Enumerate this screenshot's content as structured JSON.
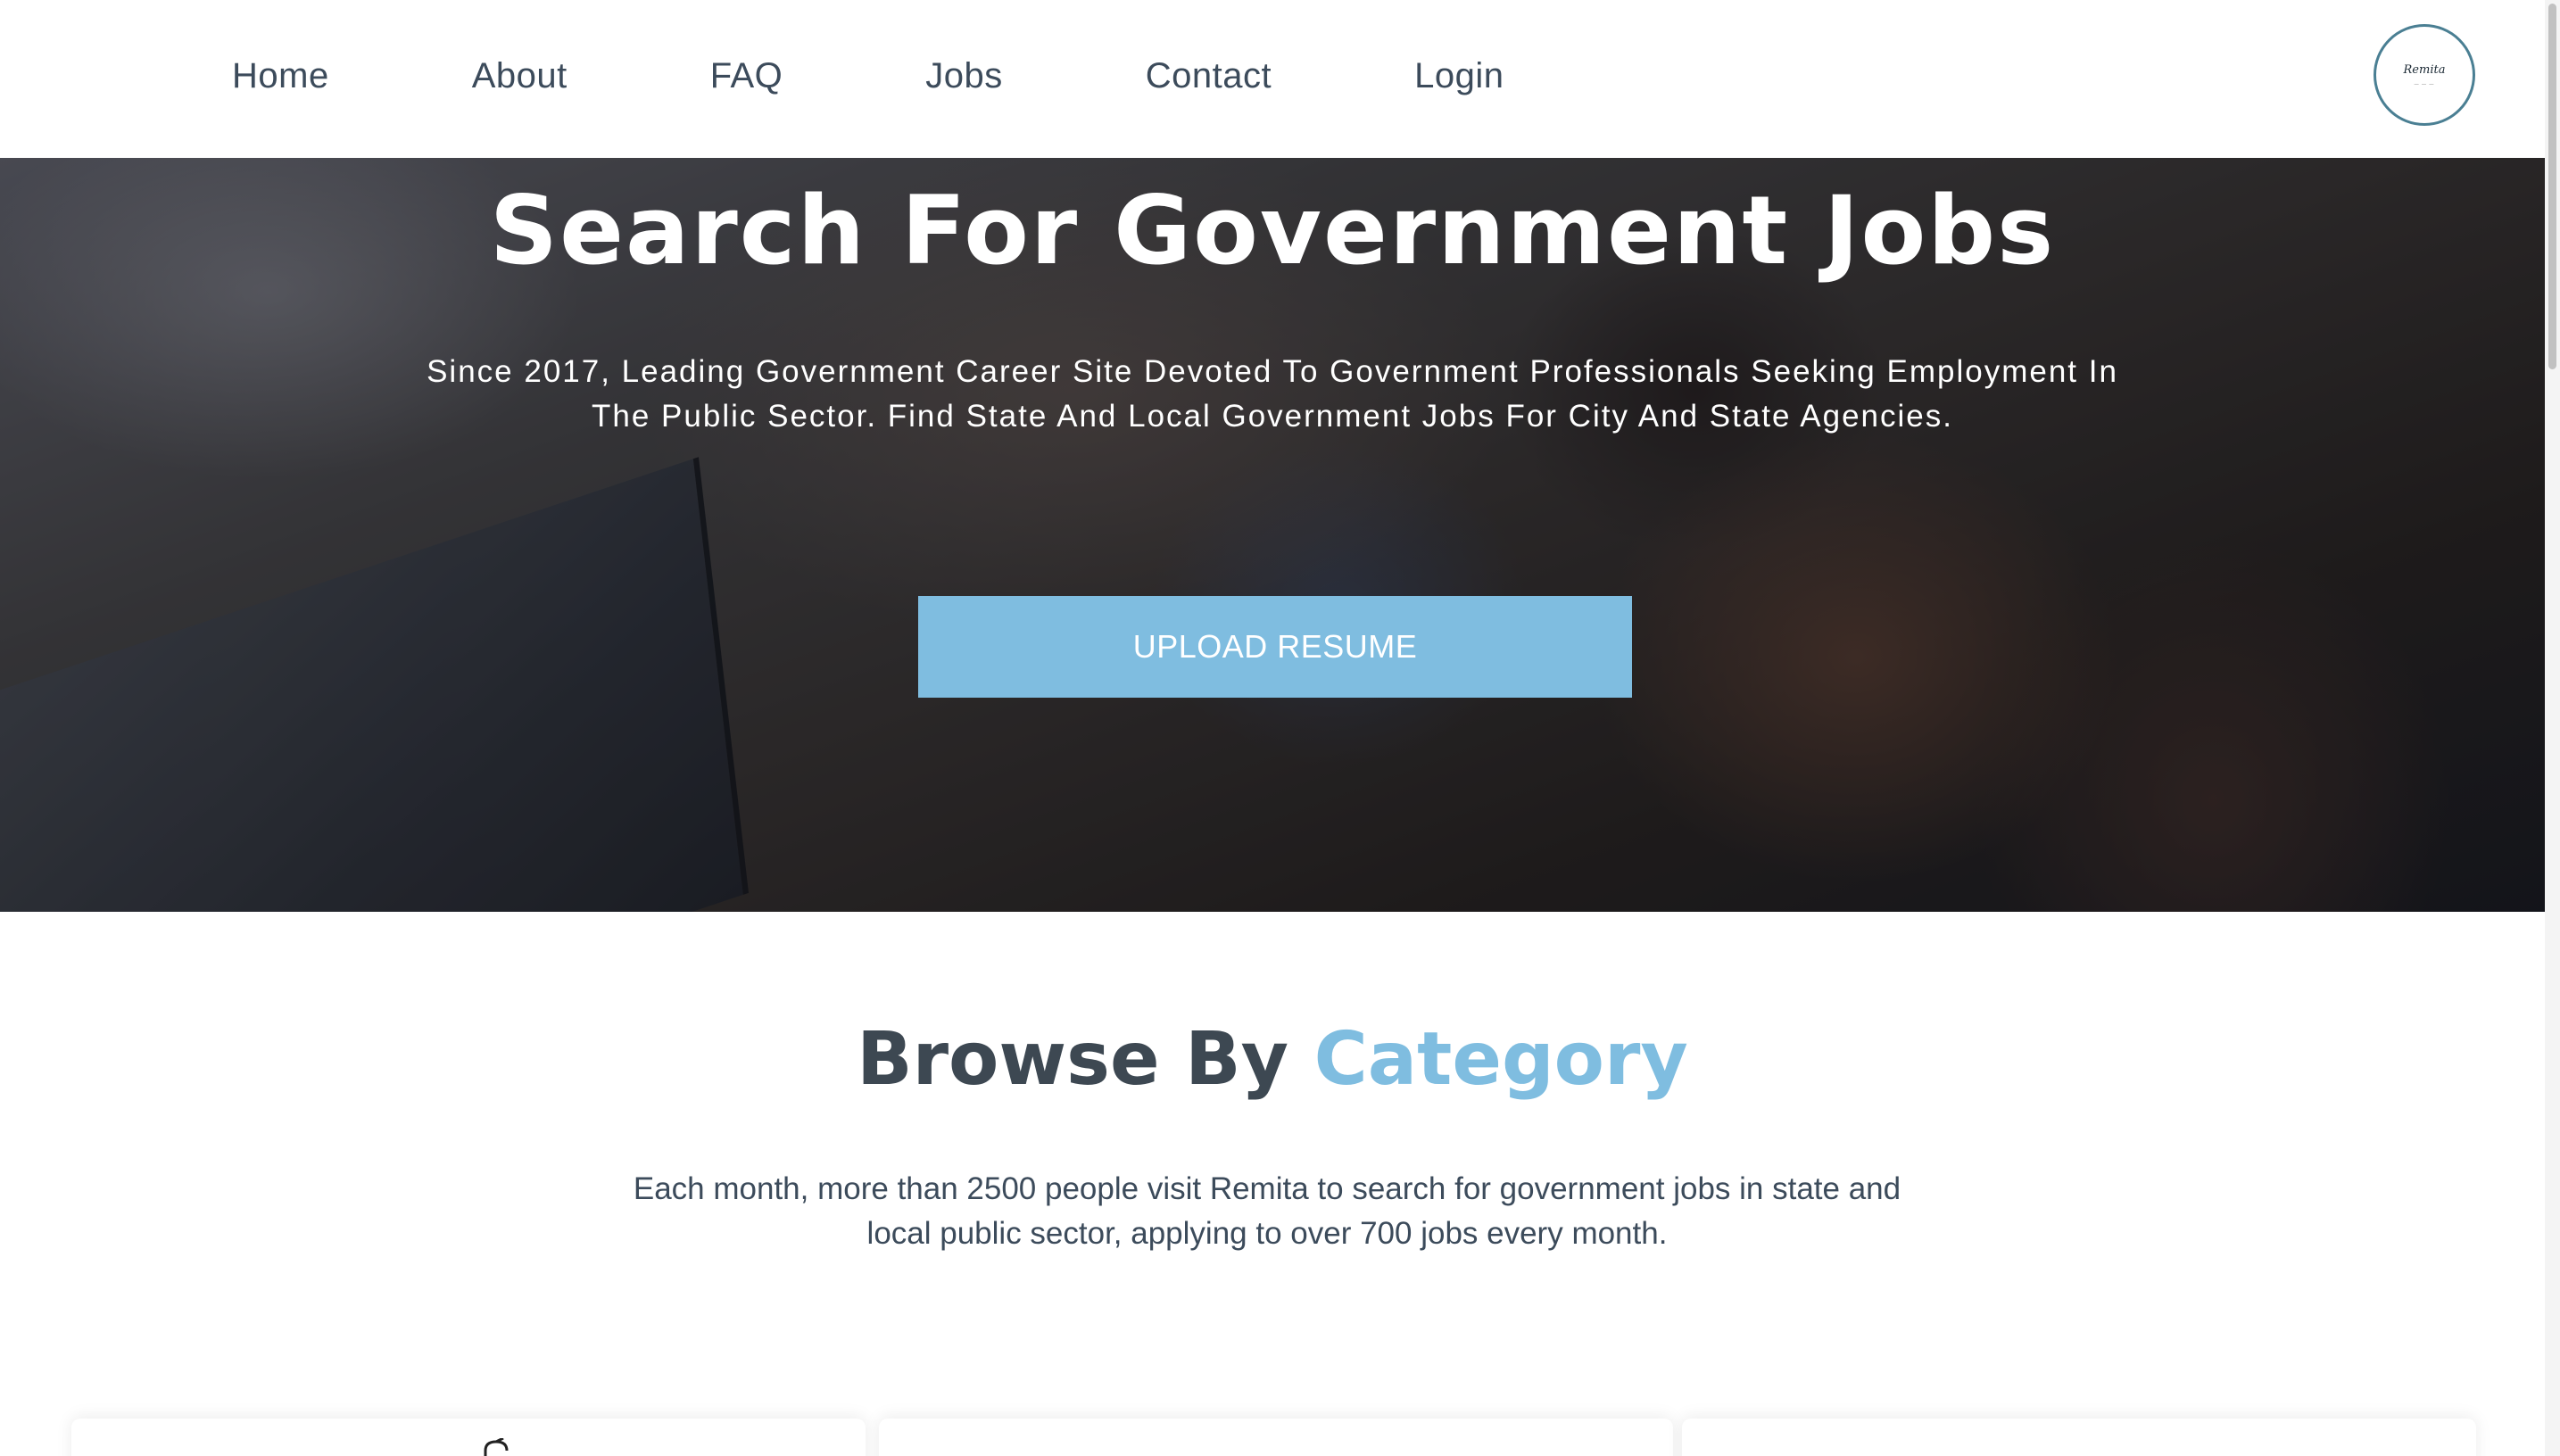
{
  "nav": {
    "links": [
      "Home",
      "About",
      "FAQ",
      "Jobs",
      "Contact",
      "Login"
    ],
    "logo_text": "Remita"
  },
  "hero": {
    "title": "Search For Government Jobs",
    "subtitle": "Since 2017, Leading Government Career Site Devoted To Government Professionals Seeking Employment In The Public Sector. Find State And Local Government Jobs For City And State Agencies.",
    "button_label": "UPLOAD RESUME"
  },
  "category": {
    "title_main": "Browse By",
    "title_accent": "Category",
    "description": "Each month, more than 2500 people visit Remita to search for government jobs in state and local public sector, applying to over 700 jobs every month.",
    "cards": [
      {
        "icon": "megaphone-icon"
      },
      {
        "icon": "building-icon"
      },
      {
        "icon": "people-icon"
      }
    ]
  },
  "colors": {
    "accent": "#7fbde0",
    "heading": "#3d4852",
    "nav_text": "#3c4b5b"
  }
}
